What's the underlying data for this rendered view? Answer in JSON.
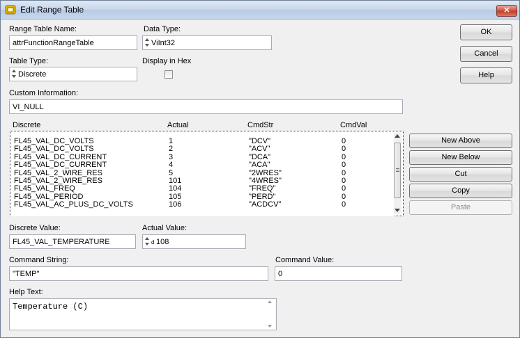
{
  "window": {
    "title": "Edit Range Table",
    "close_glyph": "✕"
  },
  "fields": {
    "range_table_name": {
      "label": "Range Table Name:",
      "value": "attrFunctionRangeTable"
    },
    "data_type": {
      "label": "Data Type:",
      "value": "ViInt32"
    },
    "table_type": {
      "label": "Table Type:",
      "value": "Discrete"
    },
    "display_in_hex": {
      "label": "Display in Hex",
      "checked": false
    },
    "custom_information": {
      "label": "Custom Information:",
      "value": "VI_NULL"
    },
    "discrete_value": {
      "label": "Discrete Value:",
      "value": "FL45_VAL_TEMPERATURE"
    },
    "actual_value": {
      "label": "Actual Value:",
      "prefix": "d",
      "value": "108"
    },
    "command_string": {
      "label": "Command String:",
      "value": "\"TEMP\""
    },
    "command_value": {
      "label": "Command Value:",
      "value": "0"
    },
    "help_text": {
      "label": "Help Text:",
      "value": "Temperature (C)"
    }
  },
  "buttons": {
    "ok": "OK",
    "cancel": "Cancel",
    "help": "Help",
    "new_above": "New Above",
    "new_below": "New Below",
    "cut": "Cut",
    "copy": "Copy",
    "paste": "Paste"
  },
  "table": {
    "columns": [
      "Discrete",
      "Actual",
      "CmdStr",
      "CmdVal"
    ],
    "rows": [
      [
        "FL45_VAL_DC_VOLTS",
        "1",
        "\"DCV\"",
        "0"
      ],
      [
        "FL45_VAL_DC_VOLTS",
        "2",
        "\"ACV\"",
        "0"
      ],
      [
        "FL45_VAL_DC_CURRENT",
        "3",
        "\"DCA\"",
        "0"
      ],
      [
        "FL45_VAL_DC_CURRENT",
        "4",
        "\"ACA\"",
        "0"
      ],
      [
        "FL45_VAL_2_WIRE_RES",
        "5",
        "\"2WRES\"",
        "0"
      ],
      [
        "FL45_VAL_2_WIRE_RES",
        "101",
        "\"4WRES\"",
        "0"
      ],
      [
        "FL45_VAL_FREQ",
        "104",
        "\"FREQ\"",
        "0"
      ],
      [
        "FL45_VAL_PERIOD",
        "105",
        "\"PERD\"",
        "0"
      ],
      [
        "FL45_VAL_AC_PLUS_DC_VOLTS",
        "106",
        "\"ACDCV\"",
        "0"
      ]
    ]
  },
  "colors": {
    "window_bg": "#f0f0f0",
    "close_red": "#c23a25",
    "titlebar": "#c7d6ea"
  },
  "icons": {
    "app": "labview-app-icon",
    "close": "close-icon"
  }
}
